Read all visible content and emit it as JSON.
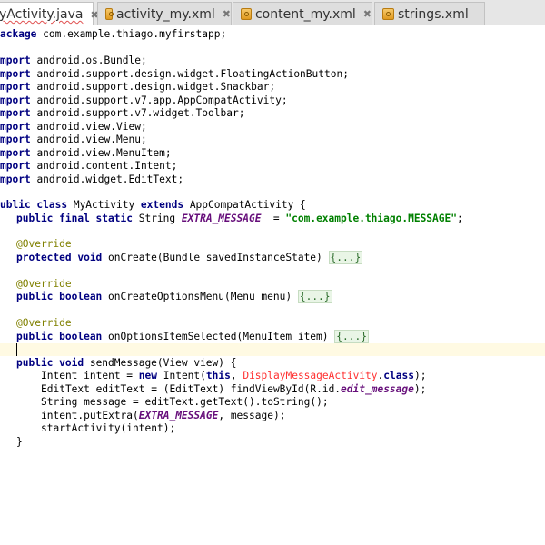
{
  "tabs": [
    {
      "label": "yActivity.java",
      "active": true,
      "has_close": true,
      "icon": "java-file-icon"
    },
    {
      "label": "activity_my.xml",
      "active": false,
      "has_close": true,
      "icon": "xml-file-icon"
    },
    {
      "label": "content_my.xml",
      "active": false,
      "has_close": true,
      "icon": "xml-file-icon"
    },
    {
      "label": "strings.xml",
      "active": false,
      "has_close": false,
      "icon": "xml-file-icon"
    }
  ],
  "close_glyph": "✖",
  "code": {
    "package_kw": "ackage",
    "package_name": " com.example.thiago.myfirstapp;",
    "imports": [
      "android.os.Bundle;",
      "android.support.design.widget.FloatingActionButton;",
      "android.support.design.widget.Snackbar;",
      "android.support.v7.app.AppCompatActivity;",
      "android.support.v7.widget.Toolbar;",
      "android.view.View;",
      "android.view.Menu;",
      "android.view.MenuItem;",
      "android.content.Intent;",
      "android.widget.EditText;"
    ],
    "import_kw": "mport",
    "class_kw1": "ublic class",
    "class_name": " MyActivity ",
    "extends_kw": "extends",
    "superclass": " AppCompatActivity {",
    "field_kw": "public final static",
    "field_type": " String ",
    "field_name": "EXTRA_MESSAGE",
    "field_eq": "  = ",
    "field_value": "\"com.example.thiago.MESSAGE\"",
    "semicolon": ";",
    "override": "@Override",
    "protected_void": "protected void",
    "oncreate_sig": " onCreate(Bundle savedInstanceState) ",
    "public_boolean": "public boolean",
    "oncreateoptions_sig": " onCreateOptionsMenu(Menu menu) ",
    "onoptions_sig": " onOptionsItemSelected(MenuItem item) ",
    "fold": "{...}",
    "public_void": "public void",
    "sendmessage_sig": " sendMessage(View view) {",
    "intent_decl": "Intent intent = ",
    "new_kw": "new",
    "intent_ctor": " Intent(",
    "this_kw": "this",
    "comma": ", ",
    "display_activity": "DisplayMessageActivity",
    "dot": ".",
    "class_kw": "class",
    "close_paren": ");",
    "edittext_decl": "EditText editText = (EditText) findViewById(R.id.",
    "edit_message": "edit_message",
    "string_decl": "String message = editText.getText().toString();",
    "putextra_open": "intent.putExtra(",
    "putextra_rest": ", message);",
    "start_activity": "startActivity(intent);",
    "close_brace": "}"
  }
}
